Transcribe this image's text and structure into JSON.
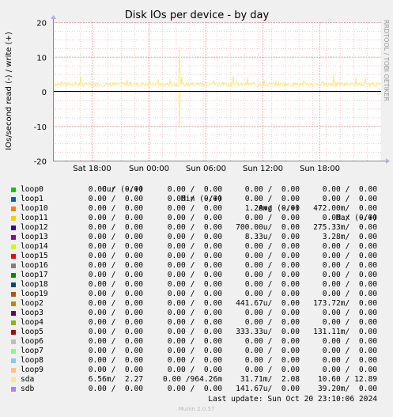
{
  "chart_data": {
    "type": "line",
    "title": "Disk IOs per device - by day",
    "ylabel": "IOs/second read (-) / write (+)",
    "ylim": [
      -20,
      20
    ],
    "yticks": [
      20,
      10,
      0,
      -10,
      -20
    ],
    "xticks": [
      "Sat 18:00",
      "Sun 00:00",
      "Sun 06:00",
      "Sun 12:00",
      "Sun 18:00"
    ],
    "grid": true,
    "side_label": "RRDTOOL / TOBI OETIKER",
    "series": [
      {
        "name": "sda",
        "color": "#ffe880",
        "direction": "write",
        "typical": 2.0,
        "spike_max": 12.89
      },
      {
        "name": "sda",
        "color": "#ffe880",
        "direction": "read",
        "typical": 0.0,
        "spike_min": -10.6
      },
      {
        "name": "sdb",
        "color": "#cccc00",
        "direction": "write",
        "typical": 0.0
      }
    ]
  },
  "legend": {
    "headers": [
      "Cur (-/+)",
      "Min (-/+)",
      "Avg (-/+)",
      "Max (-/+)"
    ],
    "rows": [
      {
        "name": "loop0",
        "color": "#00cc00",
        "cur": "0.00 /  0.00",
        "min": "0.00 /  0.00",
        "avg": "0.00 /  0.00",
        "max": "0.00 /  0.00"
      },
      {
        "name": "loop1",
        "color": "#0066b3",
        "cur": "0.00 /  0.00",
        "min": "0.00 /  0.00",
        "avg": "0.00 /  0.00",
        "max": "0.00 /  0.00"
      },
      {
        "name": "loop10",
        "color": "#ff8000",
        "cur": "0.00 /  0.00",
        "min": "0.00 /  0.00",
        "avg": "1.20m/  0.00",
        "max": "472.00m/  0.00"
      },
      {
        "name": "loop11",
        "color": "#ffcc00",
        "cur": "0.00 /  0.00",
        "min": "0.00 /  0.00",
        "avg": "0.00 /  0.00",
        "max": "0.00 /  0.00"
      },
      {
        "name": "loop12",
        "color": "#330099",
        "cur": "0.00 /  0.00",
        "min": "0.00 /  0.00",
        "avg": "700.00u/  0.00",
        "max": "275.33m/  0.00"
      },
      {
        "name": "loop13",
        "color": "#990099",
        "cur": "0.00 /  0.00",
        "min": "0.00 /  0.00",
        "avg": "8.33u/  0.00",
        "max": "3.28m/  0.00"
      },
      {
        "name": "loop14",
        "color": "#ccff00",
        "cur": "0.00 /  0.00",
        "min": "0.00 /  0.00",
        "avg": "0.00 /  0.00",
        "max": "0.00 /  0.00"
      },
      {
        "name": "loop15",
        "color": "#ff0000",
        "cur": "0.00 /  0.00",
        "min": "0.00 /  0.00",
        "avg": "0.00 /  0.00",
        "max": "0.00 /  0.00"
      },
      {
        "name": "loop16",
        "color": "#808080",
        "cur": "0.00 /  0.00",
        "min": "0.00 /  0.00",
        "avg": "0.00 /  0.00",
        "max": "0.00 /  0.00"
      },
      {
        "name": "loop17",
        "color": "#008f00",
        "cur": "0.00 /  0.00",
        "min": "0.00 /  0.00",
        "avg": "0.00 /  0.00",
        "max": "0.00 /  0.00"
      },
      {
        "name": "loop18",
        "color": "#00487d",
        "cur": "0.00 /  0.00",
        "min": "0.00 /  0.00",
        "avg": "0.00 /  0.00",
        "max": "0.00 /  0.00"
      },
      {
        "name": "loop19",
        "color": "#b35a00",
        "cur": "0.00 /  0.00",
        "min": "0.00 /  0.00",
        "avg": "0.00 /  0.00",
        "max": "0.00 /  0.00"
      },
      {
        "name": "loop2",
        "color": "#b38f00",
        "cur": "0.00 /  0.00",
        "min": "0.00 /  0.00",
        "avg": "441.67u/  0.00",
        "max": "173.72m/  0.00"
      },
      {
        "name": "loop3",
        "color": "#6b006b",
        "cur": "0.00 /  0.00",
        "min": "0.00 /  0.00",
        "avg": "0.00 /  0.00",
        "max": "0.00 /  0.00"
      },
      {
        "name": "loop4",
        "color": "#8fb300",
        "cur": "0.00 /  0.00",
        "min": "0.00 /  0.00",
        "avg": "0.00 /  0.00",
        "max": "0.00 /  0.00"
      },
      {
        "name": "loop5",
        "color": "#b30000",
        "cur": "0.00 /  0.00",
        "min": "0.00 /  0.00",
        "avg": "333.33u/  0.00",
        "max": "131.11m/  0.00"
      },
      {
        "name": "loop6",
        "color": "#bebebe",
        "cur": "0.00 /  0.00",
        "min": "0.00 /  0.00",
        "avg": "0.00 /  0.00",
        "max": "0.00 /  0.00"
      },
      {
        "name": "loop7",
        "color": "#80ff80",
        "cur": "0.00 /  0.00",
        "min": "0.00 /  0.00",
        "avg": "0.00 /  0.00",
        "max": "0.00 /  0.00"
      },
      {
        "name": "loop8",
        "color": "#80c9ff",
        "cur": "0.00 /  0.00",
        "min": "0.00 /  0.00",
        "avg": "0.00 /  0.00",
        "max": "0.00 /  0.00"
      },
      {
        "name": "loop9",
        "color": "#ffc080",
        "cur": "0.00 /  0.00",
        "min": "0.00 /  0.00",
        "avg": "0.00 /  0.00",
        "max": "0.00 /  0.00"
      },
      {
        "name": "sda",
        "color": "#ffe680",
        "cur": "6.56m/  2.27",
        "min": "0.00 /964.26m",
        "avg": "31.71m/  2.08",
        "max": "10.60 / 12.89"
      },
      {
        "name": "sdb",
        "color": "#aa80ff",
        "cur": "0.00 /  0.00",
        "min": "0.00 /  0.00",
        "avg": "141.67u/  0.00",
        "max": "39.20m/  0.00"
      }
    ]
  },
  "last_update": "Last update: Sun Oct 20 23:10:06 2024",
  "footer": "Munin 2.0.57"
}
